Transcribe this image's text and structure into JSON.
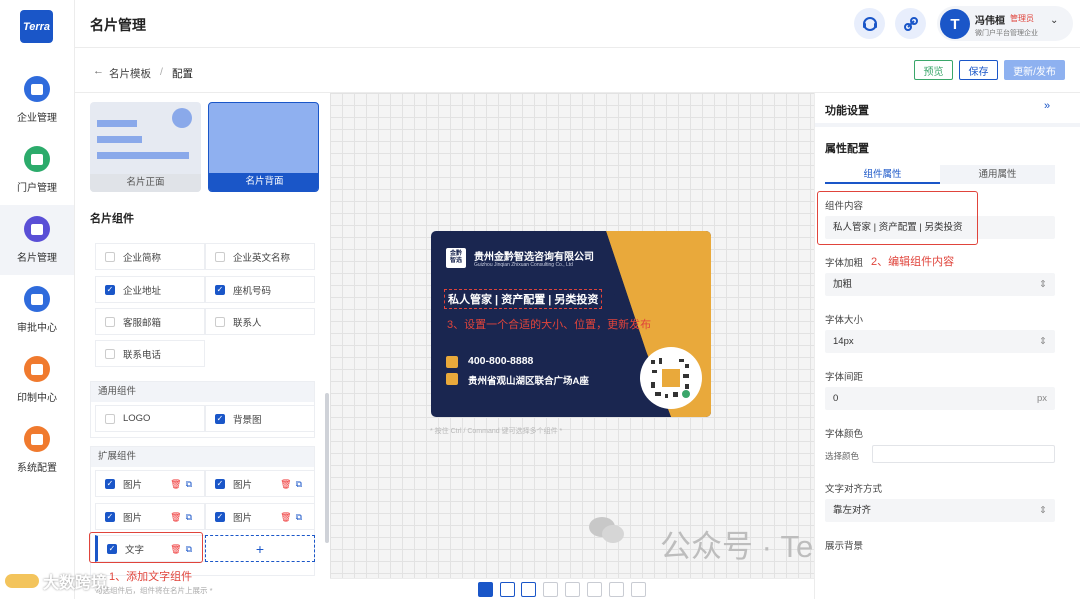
{
  "app": {
    "logo_text": "Terra"
  },
  "sidebar": {
    "items": [
      {
        "label": "企业管理",
        "icon": "building-icon",
        "color": "#2f6bdc"
      },
      {
        "label": "门户管理",
        "icon": "portal-icon",
        "color": "#2cab6b"
      },
      {
        "label": "名片管理",
        "icon": "card-icon",
        "color": "#5a4fd6",
        "active": true
      },
      {
        "label": "审批中心",
        "icon": "approve-icon",
        "color": "#2f6bdc"
      },
      {
        "label": "印制中心",
        "icon": "print-icon",
        "color": "#f07a2e"
      },
      {
        "label": "系统配置",
        "icon": "settings-icon",
        "color": "#f07a2e"
      }
    ]
  },
  "header": {
    "title": "名片管理",
    "user": {
      "name": "冯伟桓",
      "role": "管理员",
      "org": "微门户平台管理企业",
      "avatar_letter": "T"
    }
  },
  "breadcrumb": {
    "back": "名片模板",
    "sep": "/",
    "current": "配置"
  },
  "actions": {
    "preview": "预览",
    "save": "保存",
    "publish": "更新/发布"
  },
  "left": {
    "templates": [
      {
        "label": "名片正面"
      },
      {
        "label": "名片背面",
        "selected": true
      }
    ],
    "section_title": "名片组件",
    "basic_items": [
      {
        "label": "企业简称",
        "checked": false
      },
      {
        "label": "企业英文名称",
        "checked": false
      },
      {
        "label": "企业地址",
        "checked": true
      },
      {
        "label": "座机号码",
        "checked": true
      },
      {
        "label": "客服邮箱",
        "checked": false
      },
      {
        "label": "联系人",
        "checked": false
      },
      {
        "label": "联系电话",
        "checked": false
      }
    ],
    "general_title": "通用组件",
    "general_items": [
      {
        "label": "LOGO",
        "checked": false
      },
      {
        "label": "背景图",
        "checked": true
      }
    ],
    "ext_title": "扩展组件",
    "ext_items": [
      {
        "label": "图片",
        "checked": true
      },
      {
        "label": "图片",
        "checked": true
      },
      {
        "label": "图片",
        "checked": true
      },
      {
        "label": "图片",
        "checked": true
      },
      {
        "label": "文字",
        "checked": true
      }
    ],
    "add_symbol": "+",
    "footer_hint": "勾选组件后，组件将在名片上展示 *"
  },
  "canvas": {
    "hint": "* 按住 Ctrl / Command 键可选择多个组件 *",
    "card": {
      "company": "贵州金黔智选咨询有限公司",
      "company_en": "Guizhou Jinqian Zhixuan Consulting Co., Ltd",
      "logo_text": "金黔\n智选",
      "slogan": "私人管家 | 资产配置 | 另类投资",
      "phone": "400-800-8888",
      "address": "贵州省观山湖区联合广场A座",
      "colors": {
        "navy": "#1a2650",
        "gold": "#e9a93b"
      }
    }
  },
  "right": {
    "func_title": "功能设置",
    "attr_title": "属性配置",
    "tabs": [
      {
        "label": "组件属性",
        "active": true
      },
      {
        "label": "通用属性"
      }
    ],
    "content_label": "组件内容",
    "content_value": "私人管家 | 资产配置 | 另类投资",
    "bold_label": "字体加粗",
    "bold_value": "加粗",
    "size_label": "字体大小",
    "size_value": "14px",
    "spacing_label": "字体间距",
    "spacing_value": "0",
    "spacing_unit": "px",
    "color_label": "字体颜色",
    "color_pick": "选择颜色",
    "align_label": "文字对齐方式",
    "align_value": "靠左对齐",
    "bg_label": "展示背景"
  },
  "annotations": {
    "step1": "1、添加文字组件",
    "step2": "2、编辑组件内容",
    "step3": "3、设置一个合适的大小、位置，更新发布"
  },
  "watermarks": {
    "wechat": "公众号 · Terra微门户",
    "corner": "大数跨境"
  }
}
